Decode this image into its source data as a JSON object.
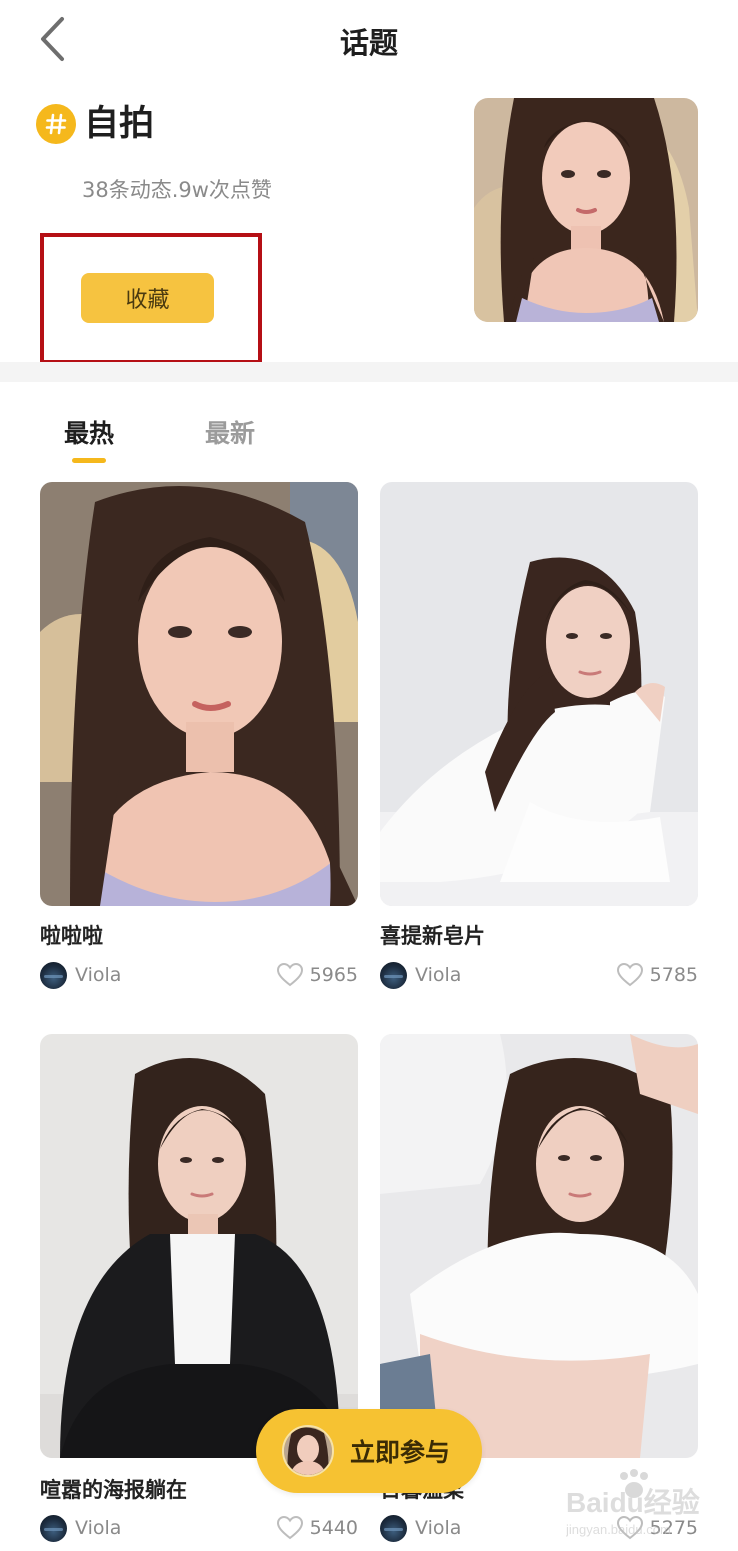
{
  "header": {
    "title": "话题"
  },
  "topic": {
    "name": "自拍",
    "stats": "38条动态.9w次点赞",
    "favorite_label": "收藏"
  },
  "tabs": [
    {
      "label": "最热",
      "active": true
    },
    {
      "label": "最新",
      "active": false
    }
  ],
  "posts": [
    {
      "title": "啦啦啦",
      "author": "Viola",
      "likes": "5965"
    },
    {
      "title": "喜提新皂片",
      "author": "Viola",
      "likes": "5785"
    },
    {
      "title": "喧嚣的海报躺在",
      "author": "Viola",
      "likes": "5440"
    },
    {
      "title": "日暮温柔",
      "author": "Viola",
      "likes": "5275"
    }
  ],
  "cta": {
    "label": "立即参与"
  },
  "watermark": {
    "text": "Baidu经验",
    "subtext": "jingyan.baidu.com"
  },
  "colors": {
    "accent": "#f5b81c",
    "button": "#f6c340",
    "highlight_border": "#b50f15",
    "muted_text": "#8a8a8a"
  }
}
